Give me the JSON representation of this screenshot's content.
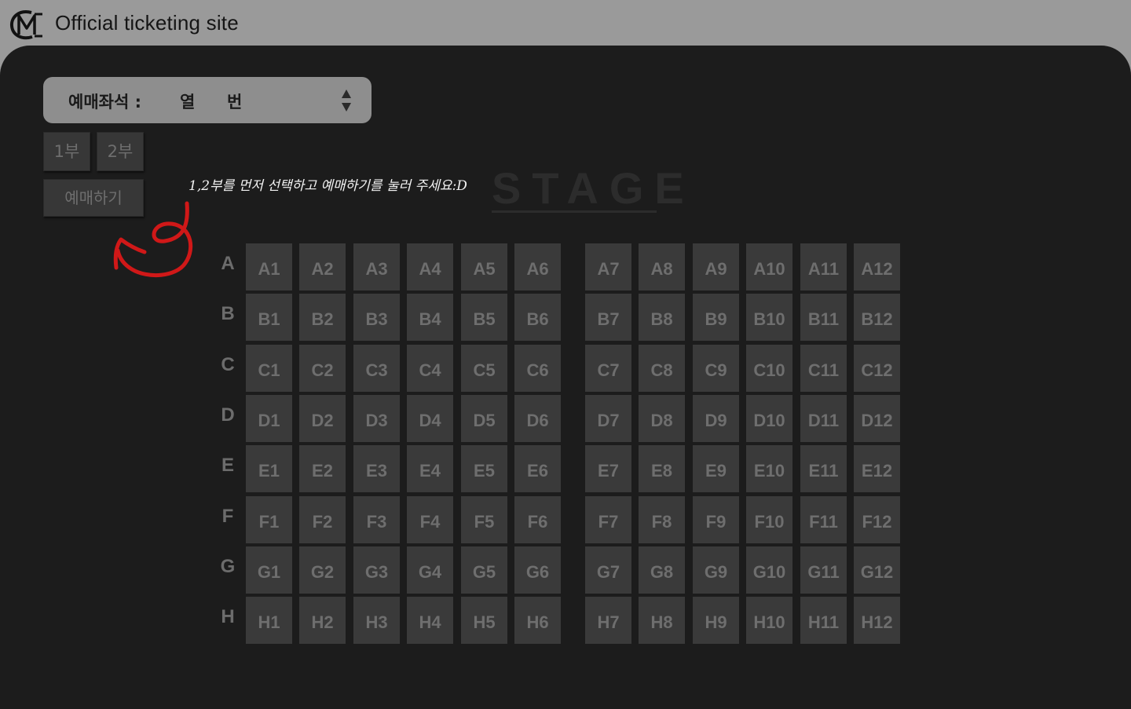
{
  "header": {
    "site_title": "Official ticketing site",
    "logo_icon": "cm-monogram-logo"
  },
  "seat_select": {
    "label": "예매좌석 :",
    "row_suffix": "열",
    "col_suffix": "번"
  },
  "parts": [
    {
      "label": "1부"
    },
    {
      "label": "2부"
    }
  ],
  "reserve_button": {
    "label": "예매하기"
  },
  "hint": {
    "text": "1,2부를 먼저 선택하고 예매하기를 눌러 주세요:D",
    "arrow_icon": "red-curly-arrow-icon"
  },
  "stage": {
    "label": "STAGE"
  },
  "rows": [
    "A",
    "B",
    "C",
    "D",
    "E",
    "F",
    "G",
    "H"
  ],
  "seats": [
    [
      "A1",
      "A2",
      "A3",
      "A4",
      "A5",
      "A6",
      "A7",
      "A8",
      "A9",
      "A10",
      "A11",
      "A12"
    ],
    [
      "B1",
      "B2",
      "B3",
      "B4",
      "B5",
      "B6",
      "B7",
      "B8",
      "B9",
      "B10",
      "B11",
      "B12"
    ],
    [
      "C1",
      "C2",
      "C3",
      "C4",
      "C5",
      "C6",
      "C7",
      "C8",
      "C9",
      "C10",
      "C11",
      "C12"
    ],
    [
      "D1",
      "D2",
      "D3",
      "D4",
      "D5",
      "D6",
      "D7",
      "D8",
      "D9",
      "D10",
      "D11",
      "D12"
    ],
    [
      "E1",
      "E2",
      "E3",
      "E4",
      "E5",
      "E6",
      "E7",
      "E8",
      "E9",
      "E10",
      "E11",
      "E12"
    ],
    [
      "F1",
      "F2",
      "F3",
      "F4",
      "F5",
      "F6",
      "F7",
      "F8",
      "F9",
      "F10",
      "F11",
      "F12"
    ],
    [
      "G1",
      "G2",
      "G3",
      "G4",
      "G5",
      "G6",
      "G7",
      "G8",
      "G9",
      "G10",
      "G11",
      "G12"
    ],
    [
      "H1",
      "H2",
      "H3",
      "H4",
      "H5",
      "H6",
      "H7",
      "H8",
      "H9",
      "H10",
      "H11",
      "H12"
    ]
  ],
  "colors": {
    "panel": "#1c1c1c",
    "seat": "#3a3a3a",
    "hint_arrow": "#d01818"
  }
}
